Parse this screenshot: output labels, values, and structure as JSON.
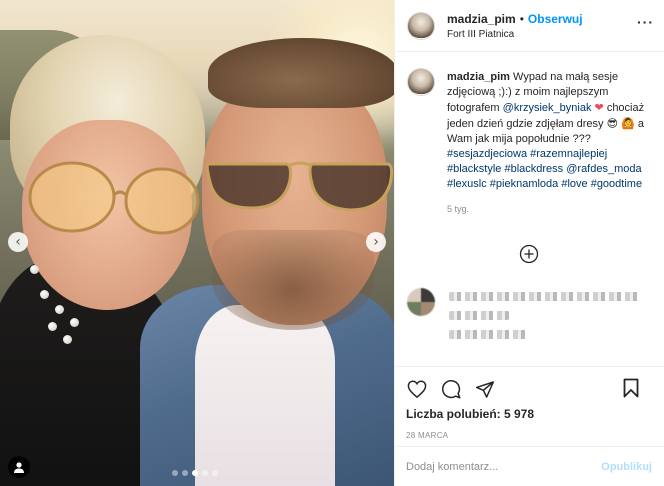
{
  "post": {
    "username": "madzia_pim",
    "follow_label": "Obserwuj",
    "location": "Fort III Piatnica",
    "more_label": "···"
  },
  "caption": {
    "username": "madzia_pim",
    "text_1": "Wypad na małą sesje zdjęciową ;):) z moim najlepszym fotografem",
    "mention_1": "@krzysiek_byniak",
    "emoji_heart": "❤",
    "text_2": "chociaż jeden dzień gdzie zdjęłam dresy",
    "emoji_sunglasses": "😎",
    "emoji_woman": "🙆",
    "text_3": "a Wam jak mija popołudnie ???",
    "hashtags_1": "#sesjazdjeciowa #razemnajlepiej #blackstyle #blackdress",
    "mention_2": "@rafdes_moda",
    "hashtags_2": "#lexuslc #pieknamloda #love #goodtime",
    "age": "5 tyg."
  },
  "engagement": {
    "likes": "Liczba polubień: 5 978",
    "date": "28 MARCA"
  },
  "comment_box": {
    "placeholder": "Dodaj komentarz...",
    "publish_label": "Opublikuj"
  },
  "carousel": {
    "prev_arrow": "‹",
    "next_arrow": "›",
    "slide_count": 5,
    "active_slide": 3
  },
  "colors": {
    "accent": "#0095f6",
    "tag": "#00376b",
    "muted": "#8e8e8e",
    "publish_disabled": "#b2dffc"
  },
  "icons": [
    "heart-icon",
    "comment-icon",
    "share-icon",
    "bookmark-icon",
    "plus-circle-icon",
    "user-tag-icon",
    "more-icon"
  ]
}
